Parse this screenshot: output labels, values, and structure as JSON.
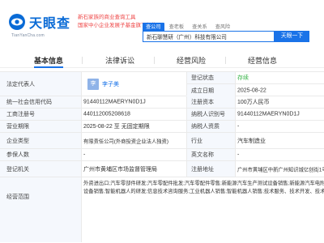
{
  "header": {
    "logo_text": "天眼查",
    "logo_url": "TianYanCha.com",
    "slogan_line1": "国家中小企业发展子基金旗下机构",
    "slogan_line2": "新石家族的商业查询工具",
    "tabs": [
      "查公司",
      "查老板",
      "查关系",
      "查风险"
    ],
    "search_value": "新石聊慧研（广州）科技有限公司",
    "search_button": "天眼一下"
  },
  "nav": {
    "items": [
      "基本信息",
      "法律诉讼",
      "经营风险",
      "经营信息"
    ],
    "active_badge": "8"
  },
  "rep": {
    "label": "法定代表人",
    "avatar_char": "李",
    "name": "李子美"
  },
  "rows": [
    {
      "l1": "",
      "v1": "",
      "l2": "登记状态",
      "v2": "存续"
    },
    {
      "l1": "",
      "v1": "",
      "l2": "成立日期",
      "v2": "2025-08-22"
    },
    {
      "l1": "统一社会信用代码",
      "v1": "91440112MAERYN0D1J",
      "l2": "注册资本",
      "v2": "100万人民币"
    },
    {
      "l1": "工商注册号",
      "v1": "440112005208618",
      "l2": "纳税人识别号",
      "v2": "91440112MAERYN0D1J"
    },
    {
      "l1": "营业期限",
      "v1": "2025-08-22 至 无固定期限",
      "l2": "纳税人资质",
      "v2": "-"
    },
    {
      "l1": "企业类型",
      "v1": "有限责任公司(外商投资企业法人独资)",
      "l2": "行业",
      "v2": "汽车制造业"
    },
    {
      "l1": "参保人数",
      "v1": "-",
      "l2": "英文名称",
      "v2": "-"
    },
    {
      "l1": "登记机关",
      "v1": "广州市黄埔区市场监督管理局",
      "l2": "注册地址",
      "v2": "广州市黄埔区中新广州知识城亿创街1号406房之899号"
    }
  ],
  "scope": {
    "label": "经营范围",
    "line1": "外资进出口;汽车零部件研发;汽车零配件批发;汽车零配件零售;新能源汽车生产测试设备销售;新能源汽车电附件销售",
    "line2": "设备销售;智能机器人的研发;信息技术咨询服务;工业机器人销售;智能机器人销售;技术服务、技术开发、技术咨询"
  },
  "colors": {
    "brand_blue": "#1a73e8",
    "status_green": "#39b54a",
    "slogan_red": "#e44444",
    "label_bg": "#f5f8fd"
  }
}
